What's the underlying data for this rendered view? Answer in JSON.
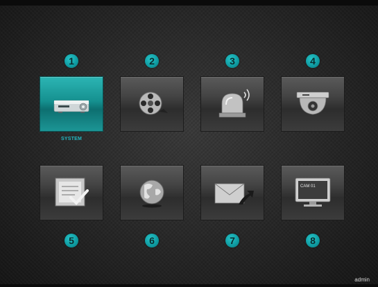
{
  "menu": {
    "items": [
      {
        "number": "1",
        "label": "SYSTEM",
        "icon": "system-device-icon"
      },
      {
        "number": "2",
        "label": "",
        "icon": "film-reel-icon"
      },
      {
        "number": "3",
        "label": "",
        "icon": "alarm-siren-icon"
      },
      {
        "number": "4",
        "label": "",
        "icon": "dome-camera-icon"
      },
      {
        "number": "5",
        "label": "",
        "icon": "checklist-icon"
      },
      {
        "number": "6",
        "label": "",
        "icon": "globe-icon"
      },
      {
        "number": "7",
        "label": "",
        "icon": "email-icon"
      },
      {
        "number": "8",
        "label": "",
        "icon": "monitor-icon"
      }
    ],
    "selected_index": 0
  },
  "monitor_screen_text": "CAM 01",
  "user": "admin",
  "colors": {
    "accent": "#1aa6aa",
    "label": "#22b8c2",
    "background": "#262626"
  }
}
